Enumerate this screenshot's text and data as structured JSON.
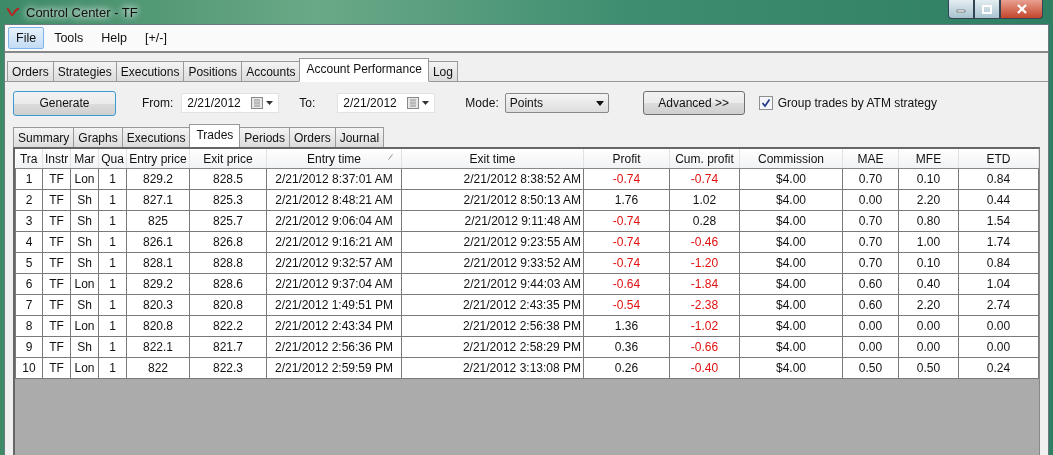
{
  "window": {
    "title": "Control Center - TF"
  },
  "menu": [
    {
      "label": "File",
      "selected": true
    },
    {
      "label": "Tools",
      "selected": false
    },
    {
      "label": "Help",
      "selected": false
    },
    {
      "label": "[+/-]",
      "selected": false
    }
  ],
  "tabs": [
    {
      "label": "Orders",
      "selected": false
    },
    {
      "label": "Strategies",
      "selected": false
    },
    {
      "label": "Executions",
      "selected": false
    },
    {
      "label": "Positions",
      "selected": false
    },
    {
      "label": "Accounts",
      "selected": false
    },
    {
      "label": "Account Performance",
      "selected": true
    },
    {
      "label": "Log",
      "selected": false
    }
  ],
  "toolbar": {
    "generate": "Generate",
    "from": {
      "label": "From:",
      "value": "2/21/2012"
    },
    "to": {
      "label": "To:",
      "value": "2/21/2012"
    },
    "mode": {
      "label": "Mode:",
      "value": "Points"
    },
    "advanced": "Advanced >>",
    "group": {
      "label": "Group trades by ATM strategy",
      "checked": true
    }
  },
  "sub_tabs": [
    {
      "label": "Summary",
      "selected": false
    },
    {
      "label": "Graphs",
      "selected": false
    },
    {
      "label": "Executions",
      "selected": false
    },
    {
      "label": "Trades",
      "selected": true
    },
    {
      "label": "Periods",
      "selected": false
    },
    {
      "label": "Orders",
      "selected": false
    },
    {
      "label": "Journal",
      "selected": false
    }
  ],
  "table": {
    "columns": [
      {
        "label": "Tra",
        "sorted": false
      },
      {
        "label": "Instr",
        "sorted": false
      },
      {
        "label": "Mar",
        "sorted": false
      },
      {
        "label": "Qua",
        "sorted": false
      },
      {
        "label": "Entry price",
        "sorted": false
      },
      {
        "label": "Exit price",
        "sorted": false
      },
      {
        "label": "Entry time",
        "sorted": true
      },
      {
        "label": "Exit time",
        "sorted": false
      },
      {
        "label": "Profit",
        "sorted": false
      },
      {
        "label": "Cum. profit",
        "sorted": false
      },
      {
        "label": "Commission",
        "sorted": false
      },
      {
        "label": "MAE",
        "sorted": false
      },
      {
        "label": "MFE",
        "sorted": false
      },
      {
        "label": "ETD",
        "sorted": false
      }
    ],
    "rows": [
      {
        "cells": [
          "1",
          "TF",
          "Lon",
          "1",
          "829.2",
          "828.5",
          "2/21/2012 8:37:01 AM",
          "2/21/2012 8:38:52 AM",
          "-0.74",
          "-0.74",
          "$4.00",
          "0.70",
          "0.10",
          "0.84"
        ],
        "profit_negative": true,
        "cum_negative": true
      },
      {
        "cells": [
          "2",
          "TF",
          "Sh",
          "1",
          "827.1",
          "825.3",
          "2/21/2012 8:48:21 AM",
          "2/21/2012 8:50:13 AM",
          "1.76",
          "1.02",
          "$4.00",
          "0.00",
          "2.20",
          "0.44"
        ],
        "profit_negative": false,
        "cum_negative": false
      },
      {
        "cells": [
          "3",
          "TF",
          "Sh",
          "1",
          "825",
          "825.7",
          "2/21/2012 9:06:04 AM",
          "2/21/2012 9:11:48 AM",
          "-0.74",
          "0.28",
          "$4.00",
          "0.70",
          "0.80",
          "1.54"
        ],
        "profit_negative": true,
        "cum_negative": false
      },
      {
        "cells": [
          "4",
          "TF",
          "Sh",
          "1",
          "826.1",
          "826.8",
          "2/21/2012 9:16:21 AM",
          "2/21/2012 9:23:55 AM",
          "-0.74",
          "-0.46",
          "$4.00",
          "0.70",
          "1.00",
          "1.74"
        ],
        "profit_negative": true,
        "cum_negative": true
      },
      {
        "cells": [
          "5",
          "TF",
          "Sh",
          "1",
          "828.1",
          "828.8",
          "2/21/2012 9:32:57 AM",
          "2/21/2012 9:33:52 AM",
          "-0.74",
          "-1.20",
          "$4.00",
          "0.70",
          "0.10",
          "0.84"
        ],
        "profit_negative": true,
        "cum_negative": true
      },
      {
        "cells": [
          "6",
          "TF",
          "Lon",
          "1",
          "829.2",
          "828.6",
          "2/21/2012 9:37:04 AM",
          "2/21/2012 9:44:03 AM",
          "-0.64",
          "-1.84",
          "$4.00",
          "0.60",
          "0.40",
          "1.04"
        ],
        "profit_negative": true,
        "cum_negative": true
      },
      {
        "cells": [
          "7",
          "TF",
          "Sh",
          "1",
          "820.3",
          "820.8",
          "2/21/2012 1:49:51 PM",
          "2/21/2012 2:43:35 PM",
          "-0.54",
          "-2.38",
          "$4.00",
          "0.60",
          "2.20",
          "2.74"
        ],
        "profit_negative": true,
        "cum_negative": true
      },
      {
        "cells": [
          "8",
          "TF",
          "Lon",
          "1",
          "820.8",
          "822.2",
          "2/21/2012 2:43:34 PM",
          "2/21/2012 2:56:38 PM",
          "1.36",
          "-1.02",
          "$4.00",
          "0.00",
          "0.00",
          "0.00"
        ],
        "profit_negative": false,
        "cum_negative": true
      },
      {
        "cells": [
          "9",
          "TF",
          "Sh",
          "1",
          "822.1",
          "821.7",
          "2/21/2012 2:56:36 PM",
          "2/21/2012 2:58:29 PM",
          "0.36",
          "-0.66",
          "$4.00",
          "0.00",
          "0.00",
          "0.00"
        ],
        "profit_negative": false,
        "cum_negative": true
      },
      {
        "cells": [
          "10",
          "TF",
          "Lon",
          "1",
          "822",
          "822.3",
          "2/21/2012 2:59:59 PM",
          "2/21/2012 3:13:08 PM",
          "0.26",
          "-0.40",
          "$4.00",
          "0.50",
          "0.50",
          "0.24"
        ],
        "profit_negative": false,
        "cum_negative": true
      }
    ]
  }
}
